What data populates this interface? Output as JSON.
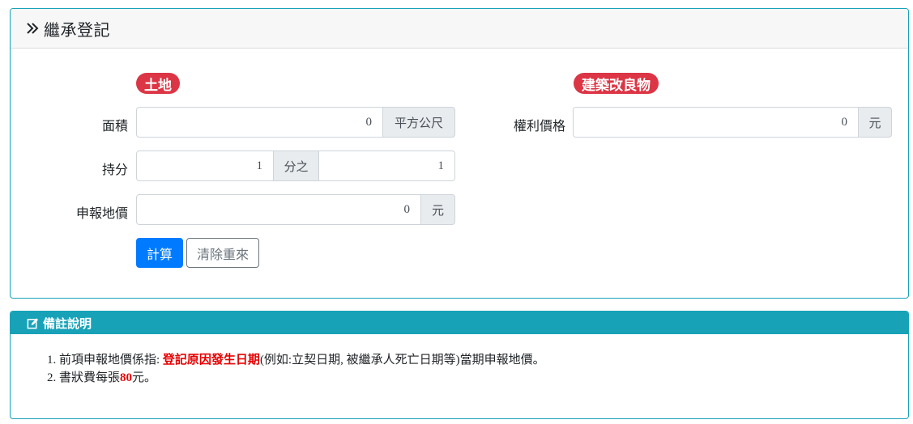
{
  "card": {
    "title": "繼承登記"
  },
  "land": {
    "badge": "土地",
    "area_label": "面積",
    "area_value": "0",
    "area_unit": "平方公尺",
    "share_label": "持分",
    "share_numerator": "1",
    "share_sep": "分之",
    "share_denominator": "1",
    "declared_label": "申報地價",
    "declared_value": "0",
    "declared_unit": "元"
  },
  "building": {
    "badge": "建築改良物",
    "rights_label": "權利價格",
    "rights_value": "0",
    "rights_unit": "元"
  },
  "buttons": {
    "calculate": "計算",
    "reset": "清除重來"
  },
  "notes": {
    "title": "備註說明",
    "item1_prefix": "前項申報地價係指: ",
    "item1_highlight": "登記原因發生日期",
    "item1_suffix": "(例如:立契日期, 被繼承人死亡日期等)當期申報地價。",
    "item2_prefix": "書狀費每張",
    "item2_highlight": "80",
    "item2_suffix": "元。"
  },
  "colors": {
    "accent": "#17a2b8",
    "badge": "#dc3545",
    "primary": "#007bff",
    "highlight": "#e60000"
  }
}
